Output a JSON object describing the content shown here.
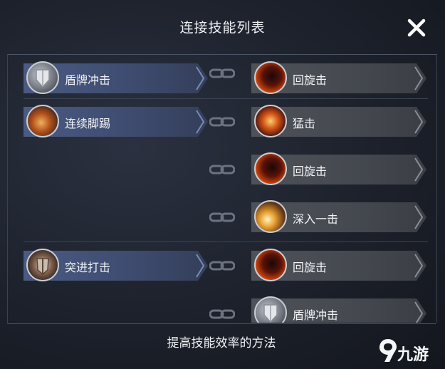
{
  "header": {
    "title": "连接技能列表",
    "close_icon": "close-icon"
  },
  "rows": [
    {
      "left": {
        "label": "盾牌冲击",
        "icon": "shield-bash-icon"
      },
      "links": [
        {
          "label": "回旋击",
          "icon": "spin-strike-icon"
        }
      ]
    },
    {
      "left": {
        "label": "连续脚踢",
        "icon": "combo-kick-icon"
      },
      "links": [
        {
          "label": "猛击",
          "icon": "smash-icon"
        },
        {
          "label": "回旋击",
          "icon": "spin-strike-icon"
        },
        {
          "label": "深入一击",
          "icon": "deep-strike-icon"
        }
      ]
    },
    {
      "left": {
        "label": "突进打击",
        "icon": "charge-strike-icon"
      },
      "links": [
        {
          "label": "回旋击",
          "icon": "spin-strike-icon"
        },
        {
          "label": "盾牌冲击",
          "icon": "shield-bash-icon"
        }
      ]
    }
  ],
  "footer": {
    "text": "提高技能效率的方法"
  },
  "watermark": {
    "text": "九游"
  },
  "colors": {
    "left_chip": "#4a5a82",
    "right_chip": "#4e5258",
    "background": "#1c212b"
  }
}
